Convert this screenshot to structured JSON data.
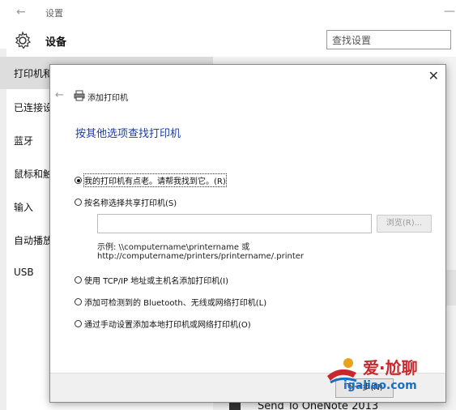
{
  "settings_window": {
    "title": "设置",
    "header": "设备",
    "search_placeholder": "查找设置",
    "nav_items": [
      "打印机和",
      "已连接设",
      "蓝牙",
      "鼠标和触",
      "输入",
      "自动播放",
      "USB"
    ],
    "bottom_item": "Send To OneNote 2013"
  },
  "dialog": {
    "title": "添加打印机",
    "heading": "按其他选项查找打印机",
    "options": [
      {
        "label": "我的打印机有点老。请帮我找到它。(R)",
        "checked": true
      },
      {
        "label": "按名称选择共享打印机(S)",
        "checked": false
      },
      {
        "label": "使用 TCP/IP 地址或主机名添加打印机(I)",
        "checked": false
      },
      {
        "label": "添加可检测到的 Bluetooth、无线或网络打印机(L)",
        "checked": false
      },
      {
        "label": "通过手动设置添加本地打印机或网络打印机(O)",
        "checked": false
      }
    ],
    "share_input_value": "",
    "browse_label": "浏览(R)...",
    "example_line1": "示例: \\\\computername\\printername 或",
    "example_line2": "http://computername/printers/printername/.printer",
    "next_label": "下一步(N)"
  },
  "watermark": {
    "cn": "爱·尬聊",
    "en": "igaliao.com"
  }
}
